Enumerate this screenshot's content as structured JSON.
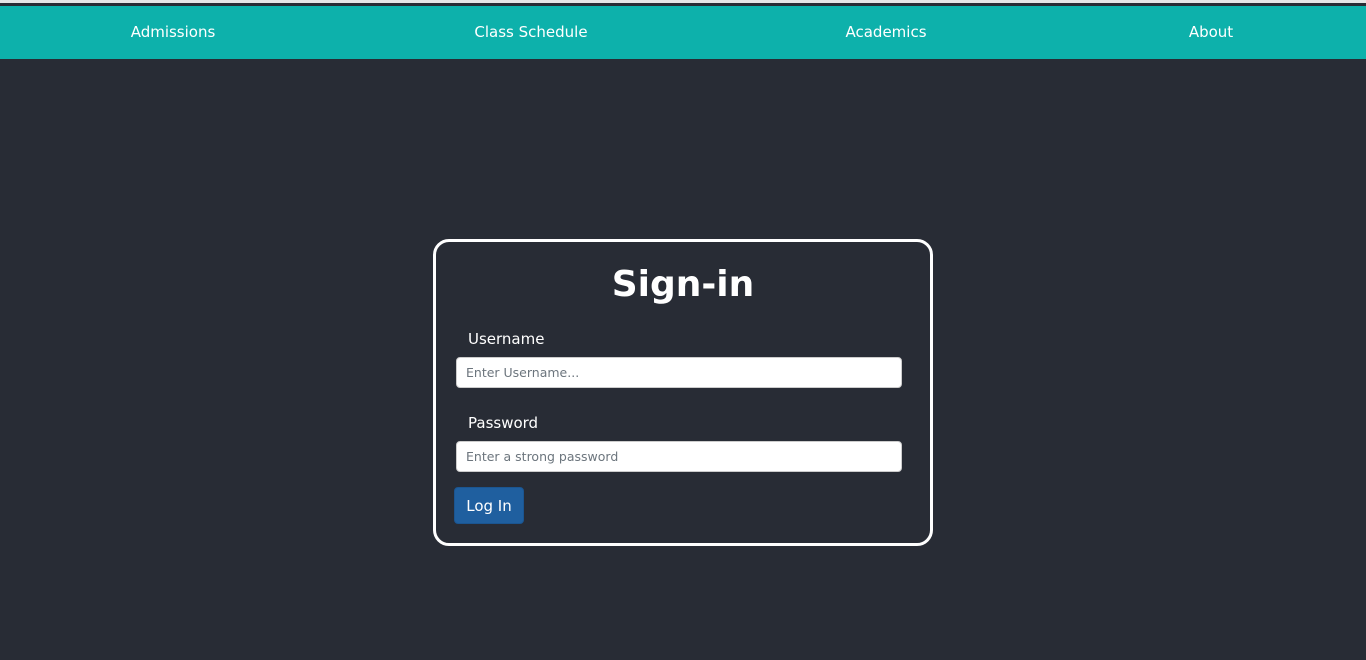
{
  "nav": {
    "items": [
      "Admissions",
      "Class Schedule",
      "Academics",
      "About"
    ]
  },
  "signin": {
    "title": "Sign-in",
    "username_label": "Username",
    "username_placeholder": "Enter Username...",
    "password_label": "Password",
    "password_placeholder": "Enter a strong password",
    "login_label": "Log In"
  },
  "colors": {
    "nav": "#0db1ab",
    "background": "#282c35",
    "button": "#1f5f9f"
  }
}
